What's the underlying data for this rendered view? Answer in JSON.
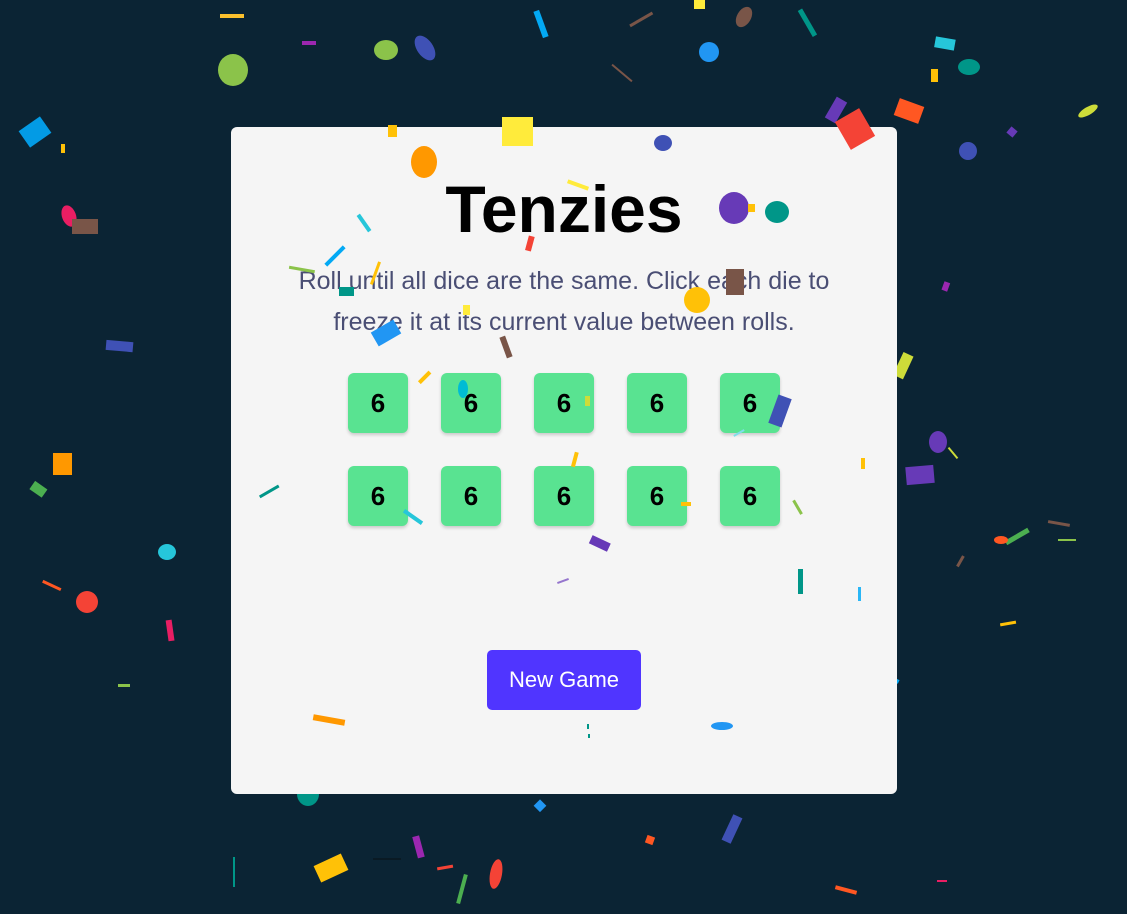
{
  "app": {
    "title": "Tenzies",
    "instructions": "Roll until all dice are the same. Click each die to freeze it at its current value between rolls."
  },
  "dice": [
    {
      "value": "6"
    },
    {
      "value": "6"
    },
    {
      "value": "6"
    },
    {
      "value": "6"
    },
    {
      "value": "6"
    },
    {
      "value": "6"
    },
    {
      "value": "6"
    },
    {
      "value": "6"
    },
    {
      "value": "6"
    },
    {
      "value": "6"
    }
  ],
  "controls": {
    "new_game_label": "New Game"
  },
  "colors": {
    "background": "#0b2434",
    "card": "#f5f5f5",
    "die": "#59e391",
    "button": "#5035ff",
    "text_muted": "#4a4e74"
  }
}
